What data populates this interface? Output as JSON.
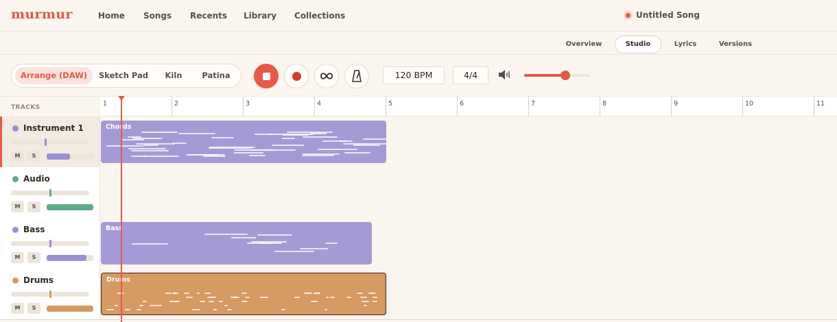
{
  "app": {
    "logo": "murmur"
  },
  "nav": [
    "Home",
    "Songs",
    "Recents",
    "Library",
    "Collections"
  ],
  "song": {
    "title": "Untitled Song"
  },
  "subtabs": [
    "Overview",
    "Studio",
    "Lyrics",
    "Versions"
  ],
  "active_subtab": "Studio",
  "modes": [
    "Arrange (DAW)",
    "Sketch Pad",
    "Kiln",
    "Patina"
  ],
  "active_mode": "Arrange (DAW)",
  "transport": {
    "stop_icon": "stop-icon",
    "record_icon": "record-icon",
    "loop_icon": "loop-icon",
    "metronome_icon": "metronome-icon",
    "tempo": "120 BPM",
    "time_signature": "4/4",
    "master_volume": 0.62
  },
  "tracks_header": "TRACKS",
  "mute_label": "M",
  "solo_label": "S",
  "tracks": [
    {
      "name": "Instrument 1",
      "color": "#9b8fd1",
      "pan": 0.44,
      "volume": 0.5,
      "selected": true
    },
    {
      "name": "Audio",
      "color": "#5fa98b",
      "pan": 0.5,
      "volume": 1.0,
      "selected": false
    },
    {
      "name": "Bass",
      "color": "#9b8fd1",
      "pan": 0.5,
      "volume": 0.85,
      "selected": false
    },
    {
      "name": "Drums",
      "color": "#d49a63",
      "pan": 0.5,
      "volume": 1.0,
      "selected": false
    }
  ],
  "ruler": {
    "bars": [
      "1",
      "2",
      "3",
      "4",
      "5",
      "6",
      "7",
      "8",
      "9",
      "10",
      "11"
    ]
  },
  "clips": [
    {
      "label": "Chords",
      "track": 0,
      "start_bar": 1,
      "end_bar": 5.0,
      "color": "#a49bd6"
    },
    {
      "label": "Bass",
      "track": 2,
      "start_bar": 1,
      "end_bar": 4.8,
      "color": "#a49bd6"
    },
    {
      "label": "Drums",
      "track": 3,
      "start_bar": 1,
      "end_bar": 5.0,
      "color": "#d69a63",
      "selected": true
    }
  ],
  "playhead_bar": 1.28
}
